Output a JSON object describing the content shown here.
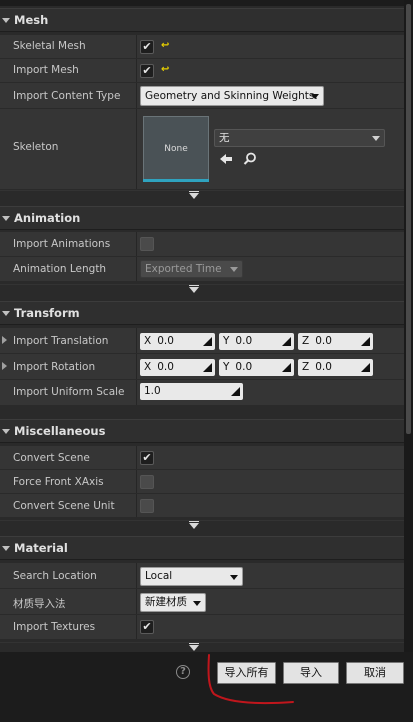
{
  "sections": {
    "mesh": {
      "title": "Mesh",
      "skeletal_mesh_label": "Skeletal Mesh",
      "import_mesh_label": "Import Mesh",
      "import_content_type_label": "Import Content Type",
      "import_content_type_value": "Geometry and Skinning Weights.",
      "skeleton_label": "Skeleton",
      "skeleton_thumb": "None",
      "skeleton_value": "无"
    },
    "animation": {
      "title": "Animation",
      "import_animations_label": "Import Animations",
      "animation_length_label": "Animation Length",
      "animation_length_value": "Exported Time"
    },
    "transform": {
      "title": "Transform",
      "import_translation_label": "Import Translation",
      "import_rotation_label": "Import Rotation",
      "import_uniform_scale_label": "Import Uniform Scale",
      "translation": {
        "x": "0.0",
        "y": "0.0",
        "z": "0.0"
      },
      "rotation": {
        "x": "0.0",
        "y": "0.0",
        "z": "0.0"
      },
      "uniform_scale": "1.0",
      "axis": {
        "x": "X",
        "y": "Y",
        "z": "Z"
      }
    },
    "misc": {
      "title": "Miscellaneous",
      "convert_scene_label": "Convert Scene",
      "force_front_xaxis_label": "Force Front XAxis",
      "convert_scene_unit_label": "Convert Scene Unit"
    },
    "material": {
      "title": "Material",
      "search_location_label": "Search Location",
      "search_location_value": "Local",
      "material_import_method_label": "材质导入法",
      "material_import_method_value": "新建材质",
      "import_textures_label": "Import Textures"
    }
  },
  "checkmark": "✔",
  "help_glyph": "?",
  "buttons": {
    "import_all": "导入所有",
    "import": "导入",
    "cancel": "取消"
  },
  "annotation_color": "#c0161c"
}
